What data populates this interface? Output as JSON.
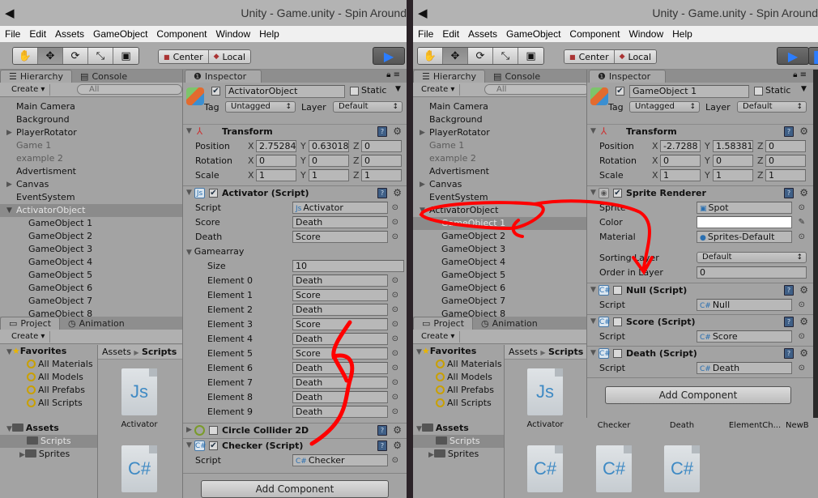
{
  "windows": [
    {
      "title": "Unity - Game.unity - Spin Around",
      "menu": [
        "File",
        "Edit",
        "Assets",
        "GameObject",
        "Component",
        "Window",
        "Help"
      ],
      "toolbar": {
        "tools": [
          "hand-icon",
          "move-icon",
          "rotate-icon",
          "scale-icon",
          "rect-icon"
        ],
        "pivot": "Center",
        "space": "Local"
      },
      "hierarchy": {
        "tabs": [
          "Hierarchy",
          "Console"
        ],
        "create": "Create ▾",
        "search_placeholder": "All",
        "items": [
          {
            "label": "Main Camera",
            "style": "normal"
          },
          {
            "label": "Background",
            "style": "normal"
          },
          {
            "label": "PlayerRotator",
            "style": "normal",
            "arrow": "▶"
          },
          {
            "label": "Game 1",
            "style": "grey"
          },
          {
            "label": "example 2",
            "style": "grey"
          },
          {
            "label": "Advertisment",
            "style": "normal"
          },
          {
            "label": "Canvas",
            "style": "normal",
            "arrow": "▶"
          },
          {
            "label": "EventSystem",
            "style": "normal"
          },
          {
            "label": "ActivatorObject",
            "style": "selected",
            "arrow": "▼"
          },
          {
            "label": "GameObject 1",
            "style": "child"
          },
          {
            "label": "GameObject 2",
            "style": "child"
          },
          {
            "label": "GameObject 3",
            "style": "child"
          },
          {
            "label": "GameObject 4",
            "style": "child"
          },
          {
            "label": "GameObject 5",
            "style": "child"
          },
          {
            "label": "GameObject 6",
            "style": "child"
          },
          {
            "label": "GameObject 7",
            "style": "child"
          },
          {
            "label": "GameObject 8",
            "style": "child"
          }
        ]
      },
      "project": {
        "tabs": [
          "Project",
          "Animation"
        ],
        "create": "Create ▾",
        "favorites_label": "Favorites",
        "favorites": [
          "All Materials",
          "All Models",
          "All Prefabs",
          "All Scripts"
        ],
        "assets_label": "Assets",
        "folders": [
          "Scripts",
          "Sprites"
        ],
        "breadcrumb": [
          "Assets",
          "Scripts"
        ],
        "files": [
          {
            "name": "Activator",
            "type": "Js"
          },
          {
            "name": "",
            "type": "C#"
          }
        ]
      },
      "inspector": {
        "tab": "Inspector",
        "object_name": "ActivatorObject",
        "static_label": "Static",
        "tag_label": "Tag",
        "tag": "Untagged",
        "layer_label": "Layer",
        "layer": "Default",
        "transform": {
          "title": "Transform",
          "position": [
            "2.75284",
            "0.63018",
            "0"
          ],
          "rotation": [
            "0",
            "0",
            "0"
          ],
          "scale": [
            "1",
            "1",
            "1"
          ]
        },
        "activator": {
          "title": "Activator (Script)",
          "script": "Activator",
          "score": "Death",
          "death": "Score",
          "gamearray_label": "Gamearray",
          "size_label": "Size",
          "size": "10",
          "elements": [
            "Death",
            "Score",
            "Death",
            "Score",
            "Death",
            "Score",
            "Death",
            "Death",
            "Death",
            "Death"
          ]
        },
        "circle_collider": {
          "title": "Circle Collider 2D"
        },
        "checker": {
          "title": "Checker (Script)",
          "script": "Checker"
        },
        "add_component": "Add Component"
      }
    },
    {
      "title": "Unity - Game.unity - Spin Around",
      "menu": [
        "File",
        "Edit",
        "Assets",
        "GameObject",
        "Component",
        "Window",
        "Help"
      ],
      "toolbar": {
        "pivot": "Center",
        "space": "Local"
      },
      "hierarchy": {
        "tabs": [
          "Hierarchy",
          "Console"
        ],
        "create": "Create ▾",
        "search_placeholder": "All",
        "items": [
          {
            "label": "Main Camera",
            "style": "normal"
          },
          {
            "label": "Background",
            "style": "normal"
          },
          {
            "label": "PlayerRotator",
            "style": "normal",
            "arrow": "▶"
          },
          {
            "label": "Game 1",
            "style": "grey"
          },
          {
            "label": "example 2",
            "style": "grey"
          },
          {
            "label": "Advertisment",
            "style": "normal"
          },
          {
            "label": "Canvas",
            "style": "normal",
            "arrow": "▶"
          },
          {
            "label": "EventSystem",
            "style": "normal"
          },
          {
            "label": "ActivatorObject",
            "style": "normal",
            "arrow": "▼"
          },
          {
            "label": "GameObject 1",
            "style": "child-selected"
          },
          {
            "label": "GameObject 2",
            "style": "child"
          },
          {
            "label": "GameObject 3",
            "style": "child"
          },
          {
            "label": "GameObject 4",
            "style": "child"
          },
          {
            "label": "GameObject 5",
            "style": "child"
          },
          {
            "label": "GameObject 6",
            "style": "child"
          },
          {
            "label": "GameObject 7",
            "style": "child"
          },
          {
            "label": "GameObject 8",
            "style": "child"
          }
        ]
      },
      "project": {
        "tabs": [
          "Project",
          "Animation"
        ],
        "create": "Create ▾",
        "favorites_label": "Favorites",
        "favorites": [
          "All Materials",
          "All Models",
          "All Prefabs",
          "All Scripts"
        ],
        "assets_label": "Assets",
        "folders": [
          "Scripts",
          "Sprites"
        ],
        "breadcrumb": [
          "Assets",
          "Scripts"
        ],
        "files": [
          {
            "name": "Activator",
            "type": "Js"
          },
          {
            "name": "Checker",
            "type": ""
          },
          {
            "name": "Death",
            "type": ""
          },
          {
            "name": "ElementCh...",
            "type": ""
          },
          {
            "name": "NewB",
            "type": ""
          },
          {
            "name": "",
            "type": "C#"
          },
          {
            "name": "",
            "type": "C#"
          },
          {
            "name": "",
            "type": "C#"
          }
        ]
      },
      "inspector": {
        "tab": "Inspector",
        "object_name": "GameObject 1",
        "static_label": "Static",
        "tag_label": "Tag",
        "tag": "Untagged",
        "layer_label": "Layer",
        "layer": "Default",
        "transform": {
          "title": "Transform",
          "position": [
            "-2.7288",
            "1.58381",
            "0"
          ],
          "rotation": [
            "0",
            "0",
            "0"
          ],
          "scale": [
            "1",
            "1",
            "1"
          ]
        },
        "sprite_renderer": {
          "title": "Sprite Renderer",
          "sprite": "Spot",
          "color": "#ffffff",
          "material": "Sprites-Default",
          "sorting_layer": "Default",
          "order": "0"
        },
        "null_script": {
          "title": "Null (Script)",
          "script": "Null"
        },
        "score_script": {
          "title": "Score (Script)",
          "script": "Score"
        },
        "death_script": {
          "title": "Death (Script)",
          "script": "Death"
        },
        "add_component": "Add Component"
      }
    }
  ],
  "labels": {
    "position": "Position",
    "rotation": "Rotation",
    "scale": "Scale",
    "x": "X",
    "y": "Y",
    "z": "Z",
    "script": "Script",
    "score": "Score",
    "death": "Death",
    "sprite": "Sprite",
    "color": "Color",
    "material": "Material",
    "sorting_layer": "Sorting Layer",
    "order_in_layer": "Order in Layer"
  },
  "colors": {
    "annotation": "#ff0000",
    "play": "#2b7dff",
    "panel": "#a3a3a3",
    "selection": "#8b8b8b"
  }
}
